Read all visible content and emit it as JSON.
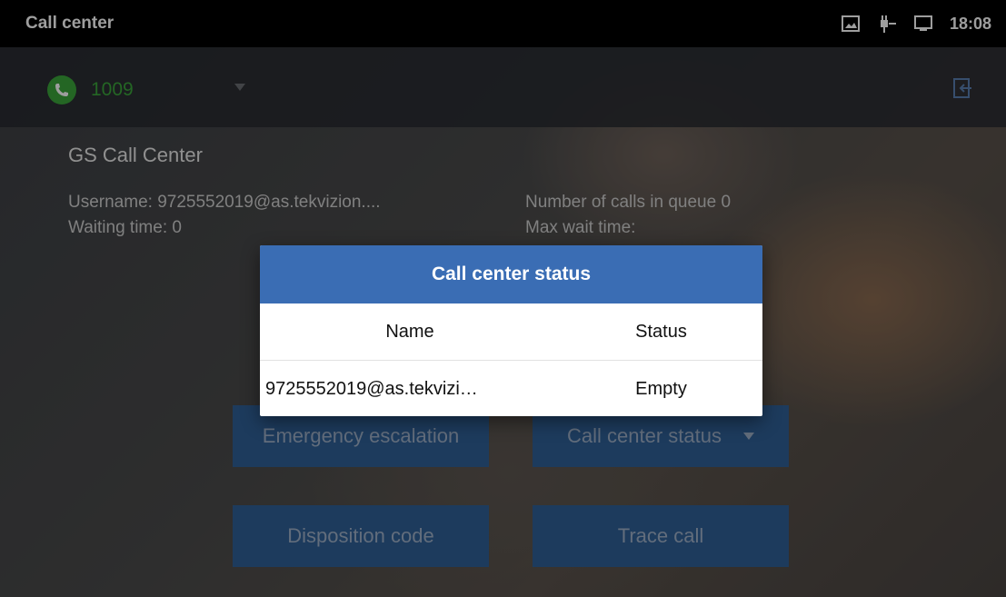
{
  "status_bar": {
    "app_title": "Call center",
    "time": "18:08",
    "icons": [
      "screenshot-icon",
      "poe-power-icon",
      "network-icon"
    ]
  },
  "account": {
    "number": "1009",
    "status_color": "#3aa53a"
  },
  "call_center": {
    "title": "GS Call Center",
    "username_line": "Username: 9725552019@as.tekvizion....",
    "waiting_line": "Waiting time: 0",
    "queue_line": "Number of calls in queue 0",
    "max_wait_line": "Max wait time:"
  },
  "buttons": {
    "emergency": "Emergency escalation",
    "status": "Call center status",
    "disposition": "Disposition code",
    "trace": "Trace call"
  },
  "dialog": {
    "title": "Call center status",
    "headers": {
      "name": "Name",
      "status": "Status"
    },
    "rows": [
      {
        "name": "9725552019@as.tekvizi…",
        "status": "Empty"
      }
    ]
  },
  "colors": {
    "accent": "#3a6db4",
    "button": "#2f5f96",
    "status_bar": "#000000"
  }
}
